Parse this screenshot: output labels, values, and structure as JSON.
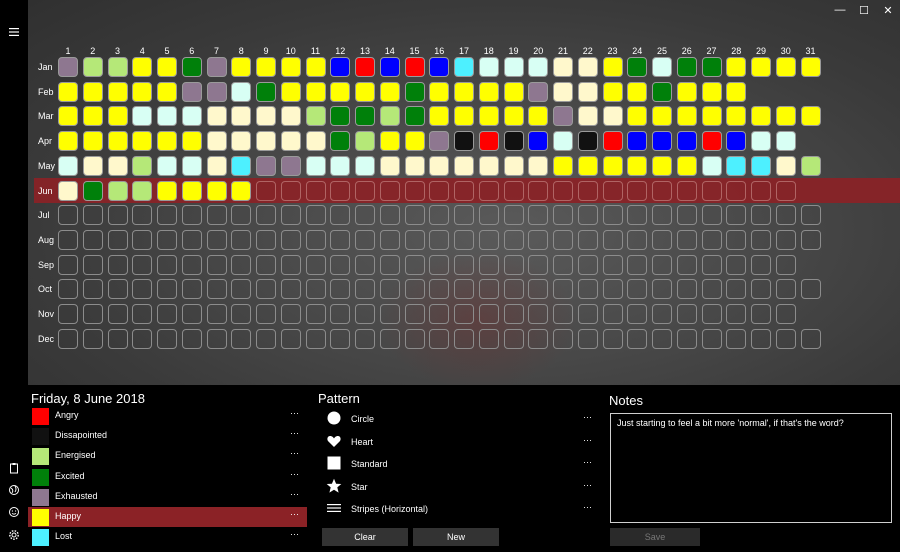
{
  "window": {
    "minimize_glyph": "—",
    "maximize_glyph": "☐",
    "close_glyph": "✕"
  },
  "grid": {
    "days": [
      "1",
      "2",
      "3",
      "4",
      "5",
      "6",
      "7",
      "8",
      "9",
      "10",
      "11",
      "12",
      "13",
      "14",
      "15",
      "16",
      "17",
      "18",
      "19",
      "20",
      "21",
      "22",
      "23",
      "24",
      "25",
      "26",
      "27",
      "28",
      "29",
      "30",
      "31"
    ],
    "months": [
      {
        "label": "Jan",
        "days": 31,
        "moods": [
          "Exhausted",
          "Energised",
          "Energised",
          "Happy",
          "Happy",
          "Excited",
          "Exhausted",
          "Happy",
          "Happy",
          "Happy",
          "Happy",
          "Blue",
          "Red",
          "Blue",
          "Red",
          "Blue",
          "Cyan",
          "LightCyan",
          "LightCyan",
          "LightCyan",
          "Cream",
          "Cream",
          "Happy",
          "Excited",
          "LightCyan",
          "Excited",
          "Excited",
          "Happy",
          "Happy",
          "Happy",
          "Happy"
        ]
      },
      {
        "label": "Feb",
        "days": 28,
        "moods": [
          "Happy",
          "Happy",
          "Happy",
          "Happy",
          "Happy",
          "Exhausted",
          "Exhausted",
          "LightCyan",
          "Excited",
          "Happy",
          "Happy",
          "Happy",
          "Happy",
          "Happy",
          "Excited",
          "Happy",
          "Happy",
          "Happy",
          "Happy",
          "Exhausted",
          "Cream",
          "Cream",
          "Happy",
          "Happy",
          "Excited",
          "Happy",
          "Happy",
          "Happy"
        ]
      },
      {
        "label": "Mar",
        "days": 31,
        "moods": [
          "Happy",
          "Happy",
          "Happy",
          "LightCyan",
          "LightCyan",
          "LightCyan",
          "Cream",
          "Cream",
          "Cream",
          "Cream",
          "Energised",
          "Excited",
          "Excited",
          "Energised",
          "Excited",
          "Happy",
          "Happy",
          "Happy",
          "Happy",
          "Happy",
          "Exhausted",
          "Cream",
          "Cream",
          "Happy",
          "Happy",
          "Happy",
          "Happy",
          "Happy",
          "Happy",
          "Happy",
          "Happy"
        ]
      },
      {
        "label": "Apr",
        "days": 30,
        "moods": [
          "Happy",
          "Happy",
          "Happy",
          "Happy",
          "Happy",
          "Happy",
          "Cream",
          "Cream",
          "Cream",
          "Cream",
          "Cream",
          "Excited",
          "Energised",
          "Happy",
          "Happy",
          "Exhausted",
          "Black",
          "Angry",
          "Black",
          "Blue",
          "LightCyan",
          "Black",
          "Angry",
          "Blue",
          "Blue",
          "Blue",
          "Angry",
          "Blue",
          "LightCyan",
          "LightCyan"
        ]
      },
      {
        "label": "May",
        "days": 31,
        "moods": [
          "LightCyan",
          "Cream",
          "Cream",
          "Energised",
          "LightCyan",
          "LightCyan",
          "Cream",
          "Lost",
          "Exhausted",
          "Exhausted",
          "LightCyan",
          "LightCyan",
          "LightCyan",
          "Cream",
          "Cream",
          "Cream",
          "Cream",
          "Cream",
          "Cream",
          "Cream",
          "Happy",
          "Happy",
          "Happy",
          "Happy",
          "Happy",
          "Happy",
          "LightCyan",
          "Lost",
          "Lost",
          "Cream",
          "Energised"
        ]
      },
      {
        "label": "Jun",
        "days": 30,
        "selected": true,
        "moods": [
          "Cream",
          "Excited",
          "Energised",
          "Energised",
          "Happy",
          "Happy",
          "Happy",
          "Happy"
        ]
      },
      {
        "label": "Jul",
        "days": 31,
        "moods": []
      },
      {
        "label": "Aug",
        "days": 31,
        "moods": []
      },
      {
        "label": "Sep",
        "days": 30,
        "moods": []
      },
      {
        "label": "Oct",
        "days": 31,
        "moods": []
      },
      {
        "label": "Nov",
        "days": 30,
        "moods": []
      },
      {
        "label": "Dec",
        "days": 31,
        "moods": []
      }
    ],
    "mood_colors": {
      "Angry": "#ff0000",
      "Dissapointed": "#111111",
      "Energised": "#b5e878",
      "Excited": "#00800a",
      "Exhausted": "#8e7790",
      "Happy": "#ffff00",
      "Lost": "#4df0ff",
      "Blue": "#0000ff",
      "Red": "#ff0000",
      "Cyan": "#4df0ff",
      "LightCyan": "#d8fff4",
      "Cream": "#fff8cc",
      "Black": "#111111"
    }
  },
  "details": {
    "date": "Friday, 8 June 2018",
    "moods": [
      {
        "label": "Angry",
        "color": "#ff0000",
        "more": "···"
      },
      {
        "label": "Dissapointed",
        "color": "#111111",
        "more": "···"
      },
      {
        "label": "Energised",
        "color": "#b5e878",
        "more": "···"
      },
      {
        "label": "Excited",
        "color": "#00800a",
        "more": "···"
      },
      {
        "label": "Exhausted",
        "color": "#8e7790",
        "more": "···"
      },
      {
        "label": "Happy",
        "color": "#ffff00",
        "more": "···",
        "selected": true
      },
      {
        "label": "Lost",
        "color": "#4df0ff",
        "more": "···"
      }
    ]
  },
  "pattern": {
    "title": "Pattern",
    "items": [
      {
        "label": "Circle",
        "icon": "circle-icon",
        "more": "···"
      },
      {
        "label": "Heart",
        "icon": "heart-icon",
        "more": "···"
      },
      {
        "label": "Standard",
        "icon": "square-icon",
        "more": "···"
      },
      {
        "label": "Star",
        "icon": "star-icon",
        "more": "···"
      },
      {
        "label": "Stripes (Horizontal)",
        "icon": "stripes-icon",
        "more": "···"
      }
    ],
    "clear_label": "Clear",
    "new_label": "New"
  },
  "notes": {
    "title": "Notes",
    "text": "Just starting to feel a bit more 'normal', if that's the word?",
    "save_label": "Save"
  }
}
